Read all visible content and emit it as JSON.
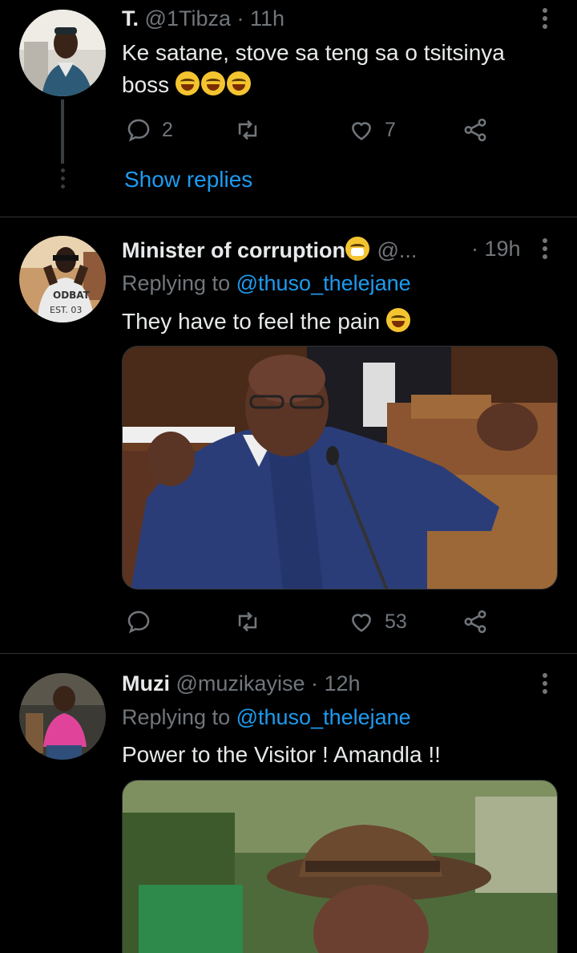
{
  "tweets": [
    {
      "name": "T.",
      "handle": "@1Tibza",
      "time": "· 11h",
      "text": "Ke satane, stove sa teng sa o tsitsinya boss",
      "emojis": 3,
      "replies": "2",
      "retweets": "",
      "likes": "7",
      "show_replies": "Show replies"
    },
    {
      "name": "Minister of corruption",
      "handle": "@...",
      "time": "· 19h",
      "replying_prefix": "Replying to",
      "replying_to": "@thuso_thelejane",
      "text": "They have to feel the pain",
      "replies": "",
      "retweets": "",
      "likes": "53",
      "avatar_shirt_text": "ODBAT Original EST. 03"
    },
    {
      "name": "Muzi",
      "handle": "@muzikayise",
      "time": "· 12h",
      "replying_prefix": "Replying to",
      "replying_to": "@thuso_thelejane",
      "text": "Power to the Visitor ! Amandla !!"
    }
  ],
  "colors": {
    "background": "#000000",
    "text": "#e7e9ea",
    "muted": "#71767b",
    "link": "#1d9bf0",
    "divider": "#2f3336"
  },
  "icons": [
    "reply-icon",
    "retweet-icon",
    "like-icon",
    "share-icon",
    "more-icon"
  ]
}
